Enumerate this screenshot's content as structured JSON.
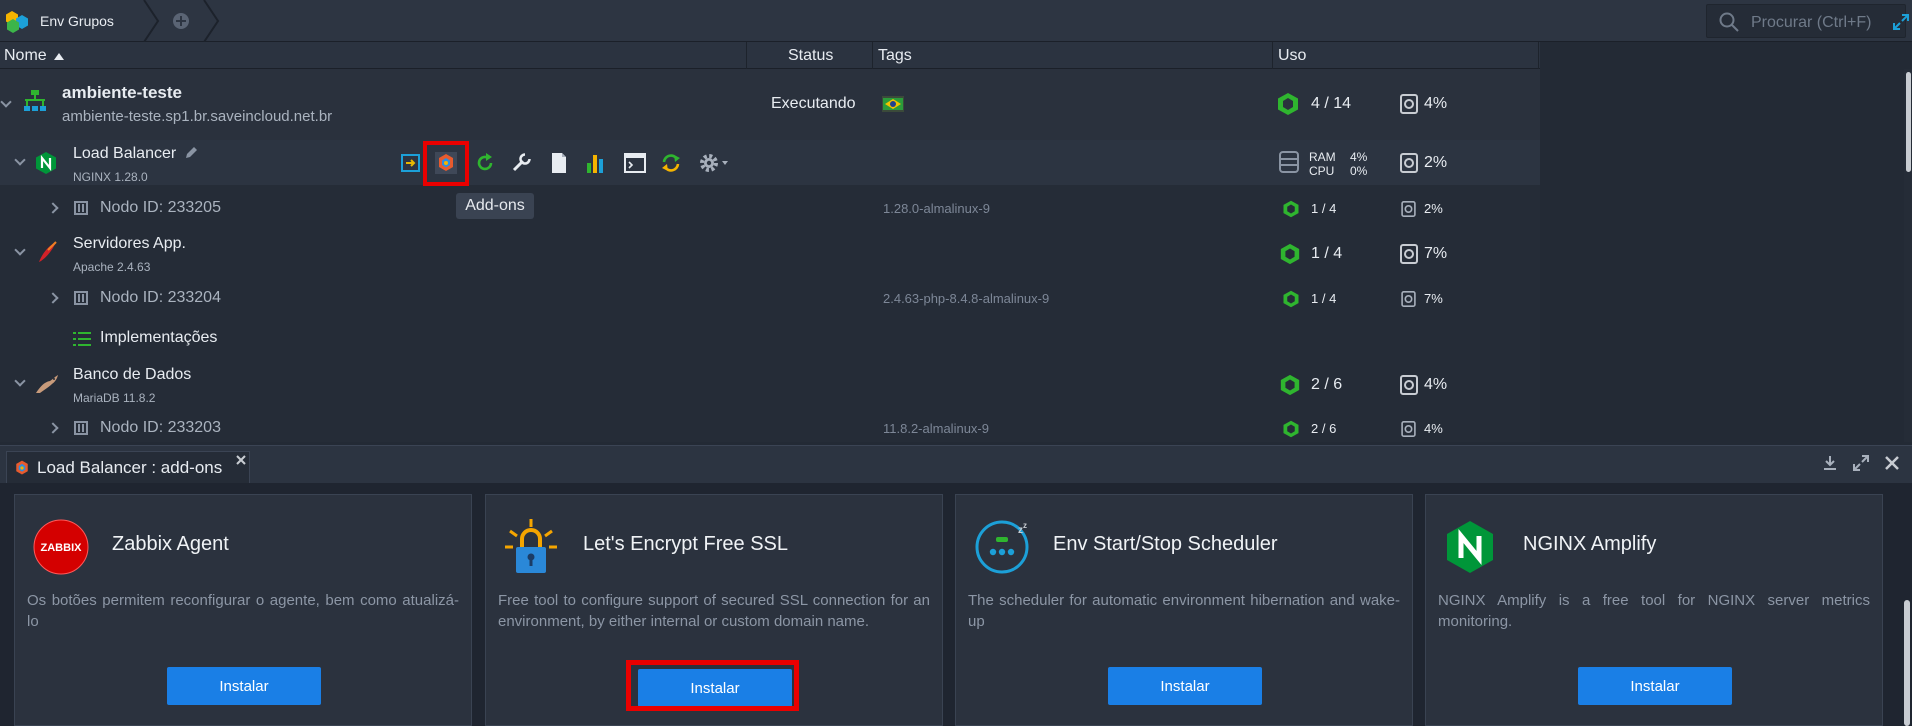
{
  "topbar": {
    "group_label": "Env Grupos",
    "search_placeholder": "Procurar (Ctrl+F)"
  },
  "table": {
    "headers": {
      "name": "Nome",
      "status": "Status",
      "tags": "Tags",
      "usage": "Uso"
    }
  },
  "environment": {
    "name": "ambiente-teste",
    "domain": "ambiente-teste.sp1.br.saveincloud.net.br",
    "status": "Executando",
    "cloudlets": "4 / 14",
    "disk": "4%"
  },
  "groups": {
    "lb": {
      "name": "Load Balancer",
      "version": "NGINX 1.28.0",
      "ram_label": "RAM",
      "cpu_label": "CPU",
      "ram": "4%",
      "cpu": "0%",
      "disk": "2%",
      "node": {
        "id": "Nodo ID: 233205",
        "tag": "1.28.0-almalinux-9",
        "cloudlets": "1 / 4",
        "disk": "2%"
      }
    },
    "app": {
      "name": "Servidores App.",
      "version": "Apache 2.4.63",
      "cloudlets": "1 / 4",
      "disk": "7%",
      "node": {
        "id": "Nodo ID: 233204",
        "tag": "2.4.63-php-8.4.8-almalinux-9",
        "cloudlets": "1 / 4",
        "disk": "7%"
      }
    },
    "deployments": "Implementações",
    "db": {
      "name": "Banco de Dados",
      "version": "MariaDB 11.8.2",
      "cloudlets": "2 / 6",
      "disk": "4%",
      "node": {
        "id": "Nodo ID: 233203",
        "tag": "11.8.2-almalinux-9",
        "cloudlets": "2 / 6",
        "disk": "4%"
      }
    }
  },
  "tooltip": "Add-ons",
  "panel": {
    "tab_title": "Load Balancer : add-ons",
    "cards": [
      {
        "title": "Zabbix Agent",
        "logo_text": "ZABBIX",
        "desc": "Os botões permitem reconfigurar o agente, bem como atualizá-lo",
        "button": "Instalar"
      },
      {
        "title": "Let's Encrypt Free SSL",
        "desc": "Free tool to configure support of secured SSL connection for an environment, by either internal or custom domain name.",
        "button": "Instalar"
      },
      {
        "title": "Env Start/Stop Scheduler",
        "desc": "The scheduler for automatic environment hibernation and wake-up",
        "button": "Instalar"
      },
      {
        "title": "NGINX Amplify",
        "desc": "NGINX Amplify is a free tool for NGINX server metrics monitoring.",
        "button": "Instalar"
      }
    ]
  },
  "colors": {
    "accent_green": "#2fb52f",
    "button_blue": "#1a7fe6",
    "highlight_red": "#ea0000"
  }
}
